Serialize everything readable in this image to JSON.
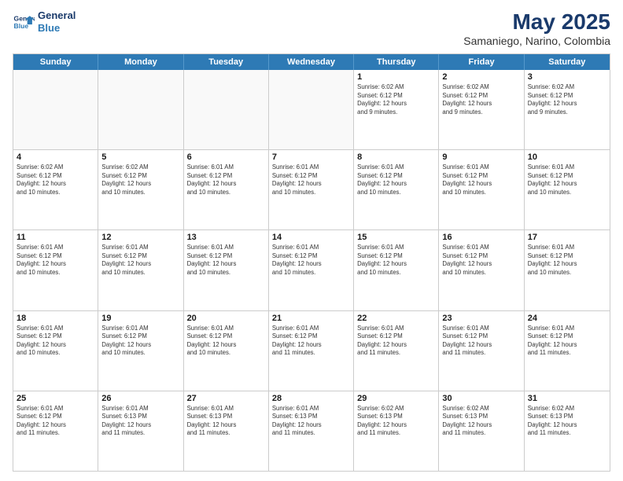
{
  "header": {
    "logo_line1": "General",
    "logo_line2": "Blue",
    "title": "May 2025",
    "subtitle": "Samaniego, Narino, Colombia"
  },
  "calendar": {
    "days_of_week": [
      "Sunday",
      "Monday",
      "Tuesday",
      "Wednesday",
      "Thursday",
      "Friday",
      "Saturday"
    ],
    "weeks": [
      [
        {
          "day": "",
          "info": "",
          "empty": true
        },
        {
          "day": "",
          "info": "",
          "empty": true
        },
        {
          "day": "",
          "info": "",
          "empty": true
        },
        {
          "day": "",
          "info": "",
          "empty": true
        },
        {
          "day": "1",
          "info": "Sunrise: 6:02 AM\nSunset: 6:12 PM\nDaylight: 12 hours\nand 9 minutes.",
          "empty": false
        },
        {
          "day": "2",
          "info": "Sunrise: 6:02 AM\nSunset: 6:12 PM\nDaylight: 12 hours\nand 9 minutes.",
          "empty": false
        },
        {
          "day": "3",
          "info": "Sunrise: 6:02 AM\nSunset: 6:12 PM\nDaylight: 12 hours\nand 9 minutes.",
          "empty": false
        }
      ],
      [
        {
          "day": "4",
          "info": "Sunrise: 6:02 AM\nSunset: 6:12 PM\nDaylight: 12 hours\nand 10 minutes.",
          "empty": false
        },
        {
          "day": "5",
          "info": "Sunrise: 6:02 AM\nSunset: 6:12 PM\nDaylight: 12 hours\nand 10 minutes.",
          "empty": false
        },
        {
          "day": "6",
          "info": "Sunrise: 6:01 AM\nSunset: 6:12 PM\nDaylight: 12 hours\nand 10 minutes.",
          "empty": false
        },
        {
          "day": "7",
          "info": "Sunrise: 6:01 AM\nSunset: 6:12 PM\nDaylight: 12 hours\nand 10 minutes.",
          "empty": false
        },
        {
          "day": "8",
          "info": "Sunrise: 6:01 AM\nSunset: 6:12 PM\nDaylight: 12 hours\nand 10 minutes.",
          "empty": false
        },
        {
          "day": "9",
          "info": "Sunrise: 6:01 AM\nSunset: 6:12 PM\nDaylight: 12 hours\nand 10 minutes.",
          "empty": false
        },
        {
          "day": "10",
          "info": "Sunrise: 6:01 AM\nSunset: 6:12 PM\nDaylight: 12 hours\nand 10 minutes.",
          "empty": false
        }
      ],
      [
        {
          "day": "11",
          "info": "Sunrise: 6:01 AM\nSunset: 6:12 PM\nDaylight: 12 hours\nand 10 minutes.",
          "empty": false
        },
        {
          "day": "12",
          "info": "Sunrise: 6:01 AM\nSunset: 6:12 PM\nDaylight: 12 hours\nand 10 minutes.",
          "empty": false
        },
        {
          "day": "13",
          "info": "Sunrise: 6:01 AM\nSunset: 6:12 PM\nDaylight: 12 hours\nand 10 minutes.",
          "empty": false
        },
        {
          "day": "14",
          "info": "Sunrise: 6:01 AM\nSunset: 6:12 PM\nDaylight: 12 hours\nand 10 minutes.",
          "empty": false
        },
        {
          "day": "15",
          "info": "Sunrise: 6:01 AM\nSunset: 6:12 PM\nDaylight: 12 hours\nand 10 minutes.",
          "empty": false
        },
        {
          "day": "16",
          "info": "Sunrise: 6:01 AM\nSunset: 6:12 PM\nDaylight: 12 hours\nand 10 minutes.",
          "empty": false
        },
        {
          "day": "17",
          "info": "Sunrise: 6:01 AM\nSunset: 6:12 PM\nDaylight: 12 hours\nand 10 minutes.",
          "empty": false
        }
      ],
      [
        {
          "day": "18",
          "info": "Sunrise: 6:01 AM\nSunset: 6:12 PM\nDaylight: 12 hours\nand 10 minutes.",
          "empty": false
        },
        {
          "day": "19",
          "info": "Sunrise: 6:01 AM\nSunset: 6:12 PM\nDaylight: 12 hours\nand 10 minutes.",
          "empty": false
        },
        {
          "day": "20",
          "info": "Sunrise: 6:01 AM\nSunset: 6:12 PM\nDaylight: 12 hours\nand 10 minutes.",
          "empty": false
        },
        {
          "day": "21",
          "info": "Sunrise: 6:01 AM\nSunset: 6:12 PM\nDaylight: 12 hours\nand 11 minutes.",
          "empty": false
        },
        {
          "day": "22",
          "info": "Sunrise: 6:01 AM\nSunset: 6:12 PM\nDaylight: 12 hours\nand 11 minutes.",
          "empty": false
        },
        {
          "day": "23",
          "info": "Sunrise: 6:01 AM\nSunset: 6:12 PM\nDaylight: 12 hours\nand 11 minutes.",
          "empty": false
        },
        {
          "day": "24",
          "info": "Sunrise: 6:01 AM\nSunset: 6:12 PM\nDaylight: 12 hours\nand 11 minutes.",
          "empty": false
        }
      ],
      [
        {
          "day": "25",
          "info": "Sunrise: 6:01 AM\nSunset: 6:12 PM\nDaylight: 12 hours\nand 11 minutes.",
          "empty": false
        },
        {
          "day": "26",
          "info": "Sunrise: 6:01 AM\nSunset: 6:13 PM\nDaylight: 12 hours\nand 11 minutes.",
          "empty": false
        },
        {
          "day": "27",
          "info": "Sunrise: 6:01 AM\nSunset: 6:13 PM\nDaylight: 12 hours\nand 11 minutes.",
          "empty": false
        },
        {
          "day": "28",
          "info": "Sunrise: 6:01 AM\nSunset: 6:13 PM\nDaylight: 12 hours\nand 11 minutes.",
          "empty": false
        },
        {
          "day": "29",
          "info": "Sunrise: 6:02 AM\nSunset: 6:13 PM\nDaylight: 12 hours\nand 11 minutes.",
          "empty": false
        },
        {
          "day": "30",
          "info": "Sunrise: 6:02 AM\nSunset: 6:13 PM\nDaylight: 12 hours\nand 11 minutes.",
          "empty": false
        },
        {
          "day": "31",
          "info": "Sunrise: 6:02 AM\nSunset: 6:13 PM\nDaylight: 12 hours\nand 11 minutes.",
          "empty": false
        }
      ]
    ]
  }
}
